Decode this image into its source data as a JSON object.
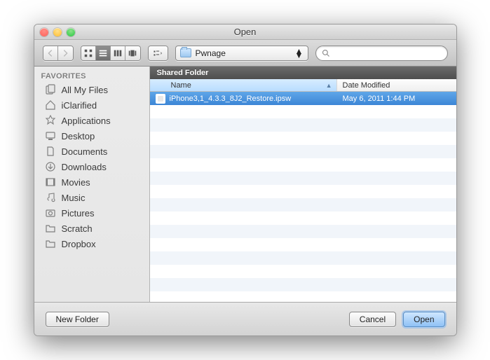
{
  "window": {
    "title": "Open"
  },
  "toolbar": {
    "path_label": "Pwnage",
    "search_placeholder": ""
  },
  "sidebar": {
    "header": "FAVORITES",
    "items": [
      {
        "label": "All My Files",
        "icon": "all-files-icon"
      },
      {
        "label": "iClarified",
        "icon": "home-icon"
      },
      {
        "label": "Applications",
        "icon": "applications-icon"
      },
      {
        "label": "Desktop",
        "icon": "desktop-icon"
      },
      {
        "label": "Documents",
        "icon": "documents-icon"
      },
      {
        "label": "Downloads",
        "icon": "downloads-icon"
      },
      {
        "label": "Movies",
        "icon": "movies-icon"
      },
      {
        "label": "Music",
        "icon": "music-icon"
      },
      {
        "label": "Pictures",
        "icon": "pictures-icon"
      },
      {
        "label": "Scratch",
        "icon": "folder-icon"
      },
      {
        "label": "Dropbox",
        "icon": "folder-icon"
      }
    ]
  },
  "content": {
    "location": "Shared Folder",
    "columns": {
      "name": "Name",
      "date": "Date Modified"
    },
    "rows": [
      {
        "name": "iPhone3,1_4.3.3_8J2_Restore.ipsw",
        "date": "May 6, 2011 1:44 PM",
        "selected": true
      }
    ]
  },
  "footer": {
    "new_folder": "New Folder",
    "cancel": "Cancel",
    "open": "Open"
  }
}
